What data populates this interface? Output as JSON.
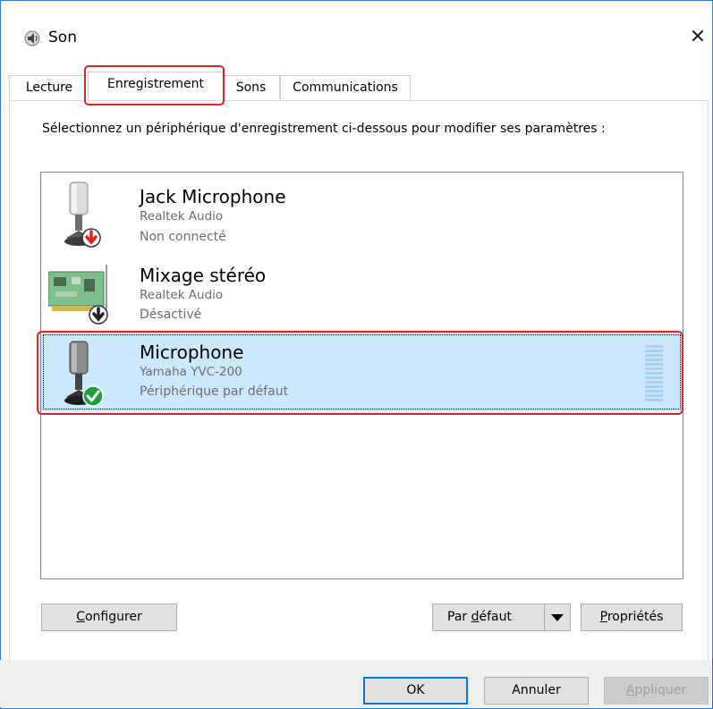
{
  "window": {
    "title": "Son",
    "close_glyph": "✕",
    "accent_color": "#0078d7",
    "highlight_color": "#e0242c"
  },
  "tabs": [
    {
      "label": "Lecture",
      "active": false
    },
    {
      "label": "Enregistrement",
      "active": true
    },
    {
      "label": "Sons",
      "active": false
    },
    {
      "label": "Communications",
      "active": false
    }
  ],
  "instructions": {
    "text": "Sélectionnez un périphérique d'enregistrement ci-dessous pour modifier ses paramètres :"
  },
  "devices": [
    {
      "name": "Jack Microphone",
      "driver": "Realtek Audio",
      "status": "Non connecté",
      "icon": "microphone-icon",
      "badge": "unplugged-arrow-icon",
      "selected": false
    },
    {
      "name": "Mixage stéréo",
      "driver": "Realtek Audio",
      "status": "Désactivé",
      "icon": "sound-card-icon",
      "badge": "disabled-arrow-icon",
      "selected": false
    },
    {
      "name": "Microphone",
      "driver": "Yamaha YVC-200",
      "status": "Périphérique par défaut",
      "icon": "microphone-icon",
      "badge": "default-check-icon",
      "selected": true,
      "level": 0
    }
  ],
  "buttons": {
    "configure": {
      "pre": "",
      "ul": "C",
      "post": "onfigurer"
    },
    "set_default": {
      "pre": "Par ",
      "ul": "d",
      "post": "éfaut"
    },
    "properties": {
      "pre": "",
      "ul": "P",
      "post": "ropriétés"
    },
    "ok": "OK",
    "cancel": "Annuler",
    "apply": {
      "pre": "",
      "ul": "A",
      "post": "ppliquer"
    }
  }
}
